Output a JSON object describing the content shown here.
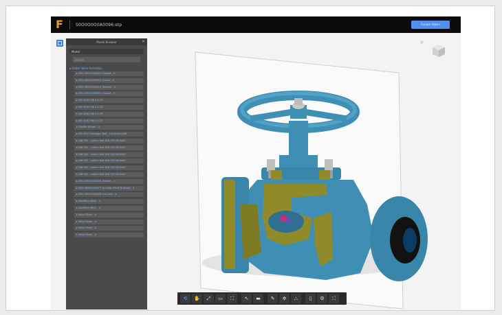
{
  "app": {
    "logo": "F",
    "file_name": "S0O0O0O0A0096.stp",
    "open_button": "Fusion Open"
  },
  "browser": {
    "title": "Model Browser",
    "close": "×",
    "model_label": "Model",
    "search_placeholder": "Search",
    "root": "▾ Globe Valve Assembly",
    "items": [
      "▸ SDS-00000-00002: Gasket - 4",
      "▸ SDS-00000-00003: Screw - 4",
      "▸ SDS-00000-00004: Washer - 4",
      "▸ SDS-00000-00005: Gasket - 4",
      "▸ ISO 4032 M8 x 1.25",
      "▸ ISO 4032 M8 x 1.25",
      "▸ ISO 4032 M8 x 1.25",
      "▸ ISO 4032 M8 x 1.25",
      "▸ Handle Wheel - 4",
      "▸ ISO 4017 Hexagon Bolt - full thread M8",
      "▸ DIN 931 - metric bolt DIN 931 M10x45",
      "▸ DIN 931 - metric bolt DIN 931 M10x45",
      "▸ DIN 931 - metric bolt DIN 931 M10x45",
      "▸ DIN 931 - metric bolt DIN 931 M10x45",
      "▸ DIN 931 - metric bolt DIN 931 M10x45",
      "▸ DIN 931 - metric bolt DIN 931 M10x45",
      "▸ SDS-00000-00006: Bolster - 4",
      "▸ SDS-00000-00007: Junction Front Bushing - 4",
      "▸ SDS-00000-00008: Lanyard - 4",
      "▸ SealRing Hitch - 4",
      "▸ SealRing Hitch - 4",
      "▸ Valve Stem - 4",
      "▸ Valve Stem - 4",
      "▸ Valve Stem - 4",
      "▸ Valve Stem - 4"
    ]
  },
  "toolbar": {
    "tools": [
      {
        "name": "orbit-tool",
        "glyph": "⟲",
        "active": true
      },
      {
        "name": "pan-tool",
        "glyph": "✋",
        "active": false
      },
      {
        "name": "zoom-tool",
        "glyph": "⤢",
        "active": false
      },
      {
        "name": "camera-tool",
        "glyph": "▭",
        "active": false
      },
      {
        "name": "fit-tool",
        "glyph": "⛶",
        "active": false
      },
      {
        "name": "measure-tool",
        "glyph": "↖",
        "active": false
      },
      {
        "name": "section-tool",
        "glyph": "▬",
        "active": false
      },
      {
        "name": "markup-tool",
        "glyph": "✎",
        "active": false
      },
      {
        "name": "explode-tool",
        "glyph": "✲",
        "active": false
      },
      {
        "name": "model-browser-tool",
        "glyph": "⛬",
        "active": false
      },
      {
        "name": "document-tool",
        "glyph": "▯",
        "active": false
      },
      {
        "name": "settings-tool",
        "glyph": "⚙",
        "active": false
      },
      {
        "name": "fullscreen-tool",
        "glyph": "⛶",
        "active": false
      }
    ]
  },
  "colors": {
    "accent": "#4e8ff0",
    "logo": "#f29a1d",
    "valve_body": "#3f8fb5",
    "section_cut": "#8f8a2a",
    "panel": "#4a4a4a"
  }
}
